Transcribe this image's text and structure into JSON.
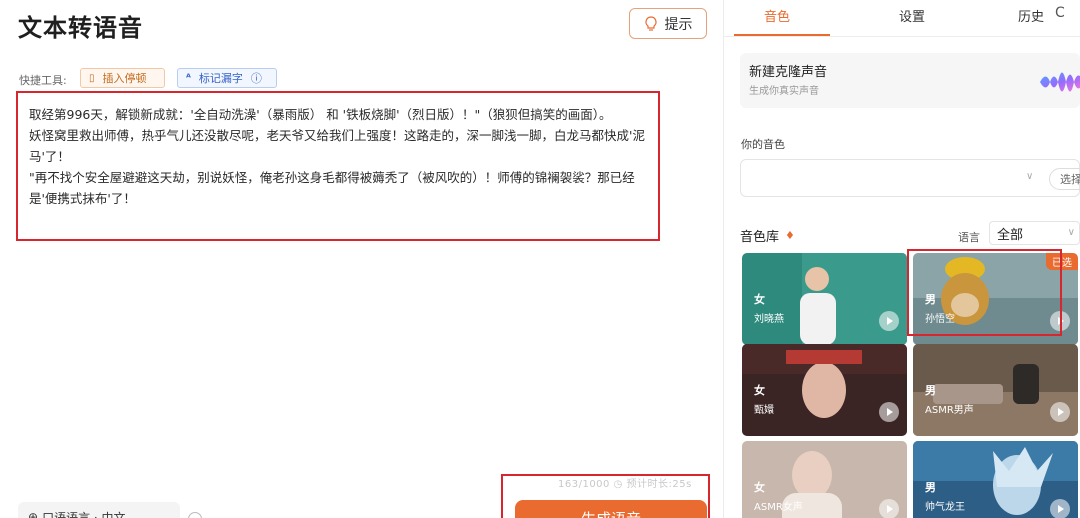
{
  "app": {
    "title": "文本转语音",
    "hint_button": "提示"
  },
  "toolbar": {
    "quick_label": "快捷工具:",
    "insert_pause": "插入停顿",
    "mark_polyphone": "标记漏字"
  },
  "editor": {
    "paragraphs": [
      "取经第996天，解锁新成就：'全自动洗澡'（暴雨版） 和 '铁板烧脚'（烈日版）！\"（狼狈但搞笑的画面）。",
      "妖怪窝里救出师傅，热乎气儿还没散尽呢，老天爷又给我们上强度！这路走的，深一脚浅一脚，白龙马都快成'泥马'了！",
      "\"再不找个安全屋避避这天劫，别说妖怪，俺老孙这身毛都得被薅秃了（被风吹的）！师傅的锦襕袈裟？那已经是'便携式抹布'了！"
    ],
    "counter": "163/1000",
    "estimate": "预计时长:25s"
  },
  "footer": {
    "language_button": "口语语言 · 中文",
    "generate_button": "生成语音"
  },
  "tabs": [
    {
      "label": "音色",
      "active": true
    },
    {
      "label": "设置",
      "active": false
    },
    {
      "label": "历史",
      "active": false
    }
  ],
  "refresh_icon": "C",
  "clone": {
    "title": "新建克隆声音",
    "subtitle": "生成你真实声音"
  },
  "my_voice": {
    "label": "你的音色",
    "select_button": "选择"
  },
  "library": {
    "title": "音色库",
    "language_label": "语言",
    "language_value": "全部",
    "cards": [
      {
        "gender": "女",
        "name": "刘晓燕",
        "badge": ""
      },
      {
        "gender": "男",
        "name": "孙悟空",
        "badge": "已选"
      },
      {
        "gender": "女",
        "name": "甄嬛",
        "badge": ""
      },
      {
        "gender": "男",
        "name": "ASMR男声",
        "badge": ""
      },
      {
        "gender": "女",
        "name": "ASMR女声",
        "badge": ""
      },
      {
        "gender": "男",
        "name": "帅气龙王",
        "badge": ""
      }
    ]
  },
  "colors": {
    "accent": "#e96b2f",
    "highlight_box": "#d8262e"
  }
}
